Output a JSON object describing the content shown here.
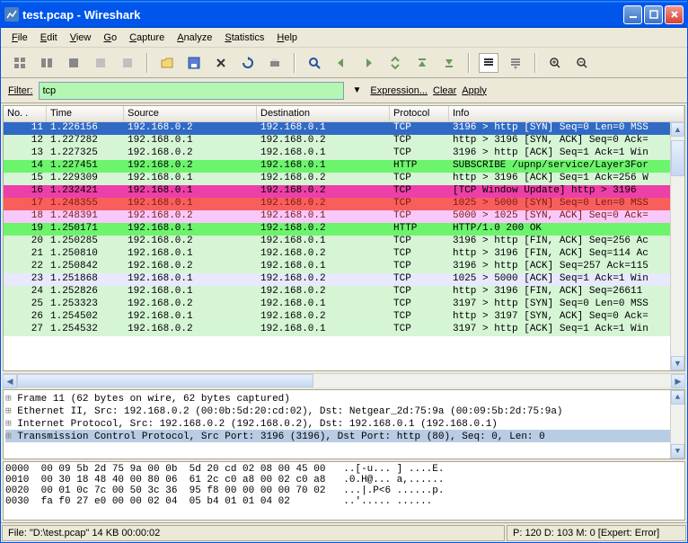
{
  "title": "test.pcap - Wireshark",
  "menu": [
    "File",
    "Edit",
    "View",
    "Go",
    "Capture",
    "Analyze",
    "Statistics",
    "Help"
  ],
  "filter": {
    "label": "Filter:",
    "value": "tcp",
    "expression": "Expression...",
    "clear": "Clear",
    "apply": "Apply"
  },
  "columns": {
    "no": "No. .",
    "time": "Time",
    "src": "Source",
    "dst": "Destination",
    "proto": "Protocol",
    "info": "Info"
  },
  "packets": [
    {
      "no": "11",
      "time": "1.226156",
      "src": "192.168.0.2",
      "dst": "192.168.0.1",
      "proto": "TCP",
      "info": "3196 > http [SYN] Seq=0 Len=0 MSS",
      "cls": "row-selected"
    },
    {
      "no": "12",
      "time": "1.227282",
      "src": "192.168.0.1",
      "dst": "192.168.0.2",
      "proto": "TCP",
      "info": "http > 3196 [SYN, ACK] Seq=0 Ack=",
      "cls": "row-green-light"
    },
    {
      "no": "13",
      "time": "1.227325",
      "src": "192.168.0.2",
      "dst": "192.168.0.1",
      "proto": "TCP",
      "info": "3196 > http [ACK] Seq=1 Ack=1 Win",
      "cls": "row-green-light"
    },
    {
      "no": "14",
      "time": "1.227451",
      "src": "192.168.0.2",
      "dst": "192.168.0.1",
      "proto": "HTTP",
      "info": "SUBSCRIBE /upnp/service/Layer3For",
      "cls": "row-green"
    },
    {
      "no": "15",
      "time": "1.229309",
      "src": "192.168.0.1",
      "dst": "192.168.0.2",
      "proto": "TCP",
      "info": "http > 3196 [ACK] Seq=1 Ack=256 W",
      "cls": "row-green-light"
    },
    {
      "no": "16",
      "time": "1.232421",
      "src": "192.168.0.1",
      "dst": "192.168.0.2",
      "proto": "TCP",
      "info": "[TCP Window Update] http > 3196 ",
      "cls": "row-magenta"
    },
    {
      "no": "17",
      "time": "1.248355",
      "src": "192.168.0.1",
      "dst": "192.168.0.2",
      "proto": "TCP",
      "info": "1025 > 5000 [SYN] Seq=0 Len=0 MSS",
      "cls": "row-pink-red"
    },
    {
      "no": "18",
      "time": "1.248391",
      "src": "192.168.0.2",
      "dst": "192.168.0.1",
      "proto": "TCP",
      "info": "5000 > 1025 [SYN, ACK] Seq=0 Ack=",
      "cls": "row-pink"
    },
    {
      "no": "19",
      "time": "1.250171",
      "src": "192.168.0.1",
      "dst": "192.168.0.2",
      "proto": "HTTP",
      "info": "HTTP/1.0 200 OK",
      "cls": "row-green"
    },
    {
      "no": "20",
      "time": "1.250285",
      "src": "192.168.0.2",
      "dst": "192.168.0.1",
      "proto": "TCP",
      "info": "3196 > http [FIN, ACK] Seq=256 Ac",
      "cls": "row-green-light"
    },
    {
      "no": "21",
      "time": "1.250810",
      "src": "192.168.0.1",
      "dst": "192.168.0.2",
      "proto": "TCP",
      "info": "http > 3196 [FIN, ACK] Seq=114 Ac",
      "cls": "row-green-light"
    },
    {
      "no": "22",
      "time": "1.250842",
      "src": "192.168.0.2",
      "dst": "192.168.0.1",
      "proto": "TCP",
      "info": "3196 > http [ACK] Seq=257 Ack=115",
      "cls": "row-green-light"
    },
    {
      "no": "23",
      "time": "1.251868",
      "src": "192.168.0.1",
      "dst": "192.168.0.2",
      "proto": "TCP",
      "info": "1025 > 5000 [ACK] Seq=1 Ack=1 Win",
      "cls": "row-plain"
    },
    {
      "no": "24",
      "time": "1.252826",
      "src": "192.168.0.1",
      "dst": "192.168.0.2",
      "proto": "TCP",
      "info": "http > 3196 [FIN, ACK] Seq=26611",
      "cls": "row-green-light"
    },
    {
      "no": "25",
      "time": "1.253323",
      "src": "192.168.0.2",
      "dst": "192.168.0.1",
      "proto": "TCP",
      "info": "3197 > http [SYN] Seq=0 Len=0 MSS",
      "cls": "row-green-light"
    },
    {
      "no": "26",
      "time": "1.254502",
      "src": "192.168.0.1",
      "dst": "192.168.0.2",
      "proto": "TCP",
      "info": "http > 3197 [SYN, ACK] Seq=0 Ack=",
      "cls": "row-green-light"
    },
    {
      "no": "27",
      "time": "1.254532",
      "src": "192.168.0.2",
      "dst": "192.168.0.1",
      "proto": "TCP",
      "info": "3197 > http [ACK] Seq=1 Ack=1 Win",
      "cls": "row-green-light"
    }
  ],
  "tree": [
    {
      "text": "Frame 11 (62 bytes on wire, 62 bytes captured)",
      "sel": false
    },
    {
      "text": "Ethernet II, Src: 192.168.0.2 (00:0b:5d:20:cd:02), Dst: Netgear_2d:75:9a (00:09:5b:2d:75:9a)",
      "sel": false
    },
    {
      "text": "Internet Protocol, Src: 192.168.0.2 (192.168.0.2), Dst: 192.168.0.1 (192.168.0.1)",
      "sel": false
    },
    {
      "text": "Transmission Control Protocol, Src Port: 3196 (3196), Dst Port: http (80), Seq: 0, Len: 0",
      "sel": true
    }
  ],
  "hex": [
    "0000  00 09 5b 2d 75 9a 00 0b  5d 20 cd 02 08 00 45 00   ..[-u... ] ....E.",
    "0010  00 30 18 48 40 00 80 06  61 2c c0 a8 00 02 c0 a8   .0.H@... a,......",
    "0020  00 01 0c 7c 00 50 3c 36  95 f8 00 00 00 00 70 02   ...|.P<6 ......p.",
    "0030  fa f0 27 e0 00 00 02 04  05 b4 01 01 04 02         ..'..... ......"
  ],
  "status": {
    "left": "File: \"D:\\test.pcap\" 14 KB 00:00:02",
    "right": "P: 120 D: 103 M: 0 [Expert: Error]"
  }
}
